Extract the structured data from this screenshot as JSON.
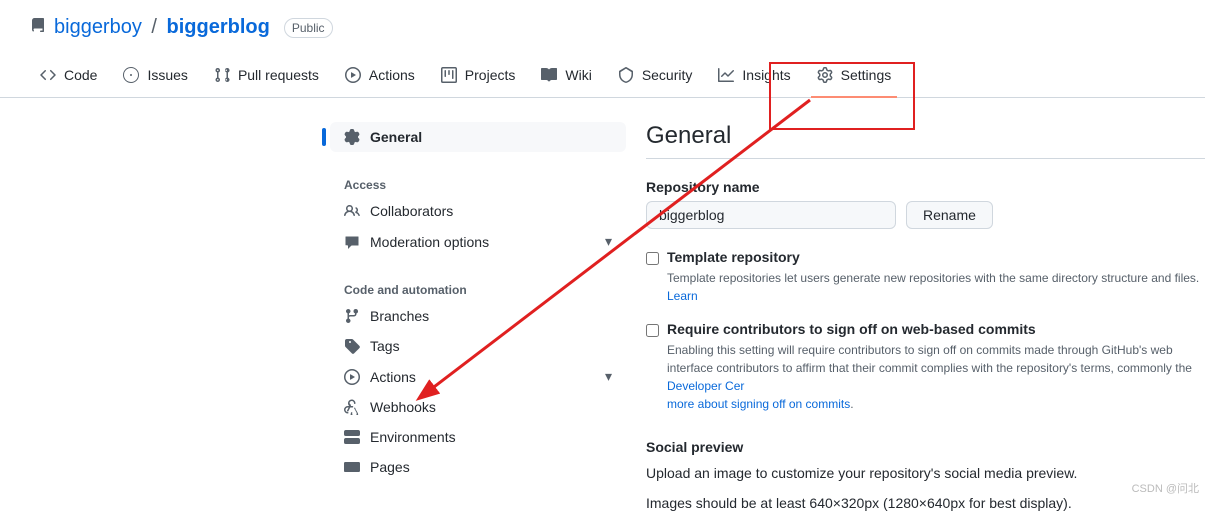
{
  "repo": {
    "owner": "biggerboy",
    "name": "biggerblog",
    "visibility": "Public"
  },
  "tabs": {
    "code": "Code",
    "issues": "Issues",
    "pulls": "Pull requests",
    "actions": "Actions",
    "projects": "Projects",
    "wiki": "Wiki",
    "security": "Security",
    "insights": "Insights",
    "settings": "Settings"
  },
  "sidebar": {
    "general": "General",
    "access_header": "Access",
    "collaborators": "Collaborators",
    "moderation": "Moderation options",
    "auto_header": "Code and automation",
    "branches": "Branches",
    "tags": "Tags",
    "actions": "Actions",
    "webhooks": "Webhooks",
    "environments": "Environments",
    "pages": "Pages"
  },
  "content": {
    "title": "General",
    "repo_name_label": "Repository name",
    "repo_name_value": "biggerblog",
    "rename_btn": "Rename",
    "template_label": "Template repository",
    "template_desc": "Template repositories let users generate new repositories with the same directory structure and files. ",
    "template_learn": "Learn",
    "signoff_label": "Require contributors to sign off on web-based commits",
    "signoff_desc1": "Enabling this setting will require contributors to sign off on commits made through GitHub's web interface contributors to affirm that their commit complies with the repository's terms, commonly the ",
    "signoff_link1": "Developer Cer",
    "signoff_link2": "more about signing off on commits",
    "social_header": "Social preview",
    "social_desc1": "Upload an image to customize your repository's social media preview.",
    "social_desc2": "Images should be at least 640×320px (1280×640px for best display)."
  },
  "watermark": "CSDN @问北"
}
